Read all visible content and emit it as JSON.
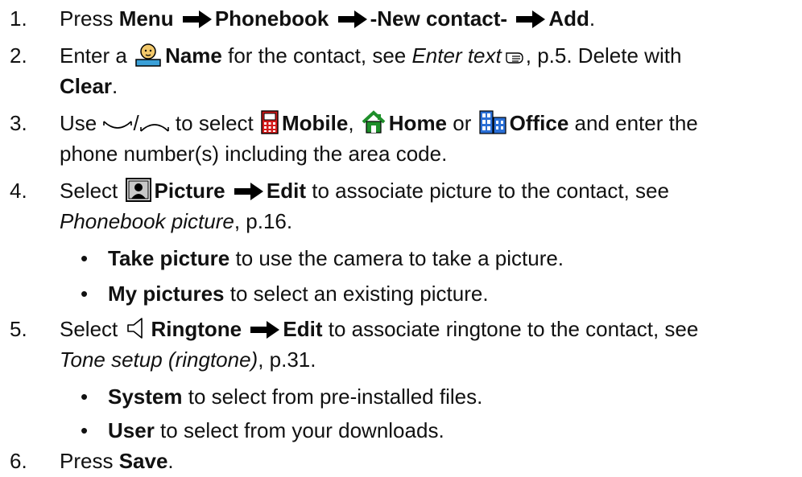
{
  "steps": [
    {
      "number": "1.",
      "parts": {
        "p1": "Press ",
        "b1": "Menu",
        "b2": "Phonebook",
        "b3": "-New contact-",
        "b4": "Add",
        "p2": "."
      }
    },
    {
      "number": "2.",
      "parts": {
        "p1": "Enter a ",
        "b1": "Name",
        "p2": " for the contact, see ",
        "i1": "Enter text",
        "p3": ", p.5. Delete with",
        "b2": "Clear",
        "p4": "."
      }
    },
    {
      "number": "3.",
      "parts": {
        "p1": "Use ",
        "p2": " to select ",
        "b1": "Mobile",
        "p3": ", ",
        "b2": "Home",
        "p4": " or ",
        "b3": "Office",
        "p5": " and enter the",
        "p6": "phone number(s) including the area code."
      }
    },
    {
      "number": "4.",
      "parts": {
        "p1": "Select ",
        "b1": "Picture",
        "b2": "Edit",
        "p2": " to associate picture to the contact, see",
        "i1": "Phonebook picture",
        "p3": ", p.16."
      },
      "bullets": [
        {
          "bold": "Take picture",
          "rest": " to use the camera to take a picture."
        },
        {
          "bold": "My pictures",
          "rest": " to select an existing picture."
        }
      ]
    },
    {
      "number": "5.",
      "parts": {
        "p1": "Select ",
        "b1": "Ringtone",
        "b2": "Edit",
        "p2": " to associate ringtone to the contact, see",
        "i1": "Tone setup (ringtone)",
        "p3": ", p.31."
      },
      "bullets": [
        {
          "bold": "System",
          "rest": " to select from pre-installed files."
        },
        {
          "bold": "User",
          "rest": " to select from your downloads."
        }
      ]
    },
    {
      "number": "6.",
      "parts": {
        "p1": "Press ",
        "b1": "Save",
        "p2": "."
      }
    }
  ],
  "bullet_glyph": "•",
  "icons": {
    "arrow": "right-arrow-icon",
    "name": "person-name-icon",
    "enter_text_ref": "hand-pointer-icon",
    "nav_down": "nav-down-key-icon",
    "nav_up": "nav-up-key-icon",
    "mobile": "mobile-phone-icon",
    "home": "house-icon",
    "office": "office-building-icon",
    "picture": "picture-icon",
    "ringtone": "speaker-icon"
  },
  "colors": {
    "text": "#111111",
    "name_icon_face": "#f2c86a",
    "name_icon_body": "#3aa0d8",
    "mobile_icon": "#d41b1b",
    "home_icon": "#1e8f2a",
    "office_icon": "#2a6fd6"
  }
}
